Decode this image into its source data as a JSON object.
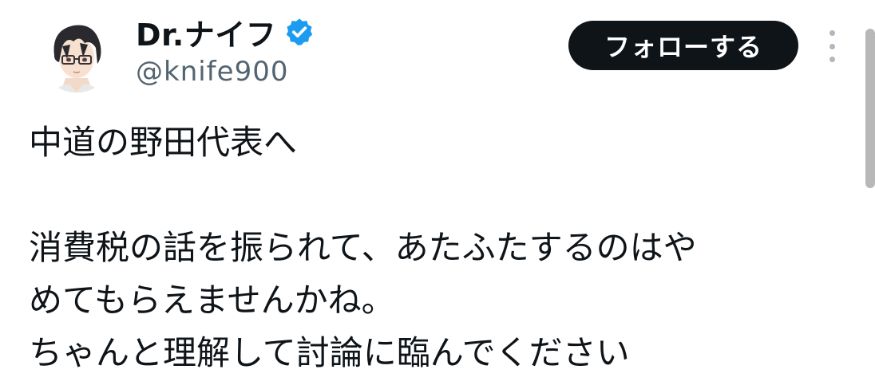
{
  "user": {
    "display_name": "Dr.ナイフ",
    "handle": "@knife900"
  },
  "icons": {
    "avatar": "anime-avatar-with-glasses",
    "verified": "verified-badge-icon",
    "more": "more-vertical-icon"
  },
  "actions": {
    "follow_label": "フォローする"
  },
  "tweet": {
    "lines": [
      "中道の野田代表へ",
      "",
      "消費税の話を振られて、あたふたするのはや",
      "めてもらえませんかね。",
      "ちゃんと理解して討論に臨んでください"
    ]
  },
  "colors": {
    "accent": "#1d9bf0",
    "button_bg": "#0f1419",
    "text_primary": "#0f1419",
    "text_secondary": "#536471"
  }
}
